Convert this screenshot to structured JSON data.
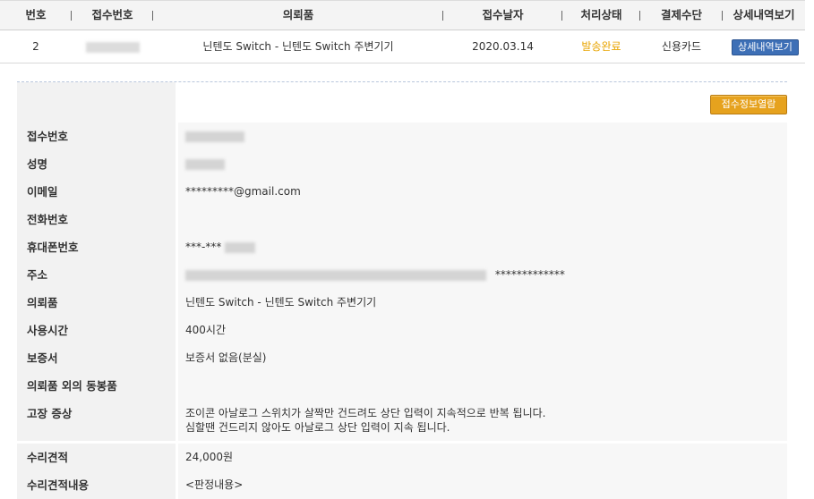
{
  "table": {
    "headers": [
      "번호",
      "접수번호",
      "의뢰품",
      "접수날자",
      "처리상태",
      "결제수단",
      "상세내역보기"
    ],
    "row": {
      "no": "2",
      "item": "닌텐도 Switch - 닌텐도 Switch 주변기기",
      "date": "2020.03.14",
      "status": "발송완료",
      "payment": "신용카드",
      "detail_button": "상세내역보기"
    }
  },
  "detail": {
    "open_button": "접수정보열람",
    "fields": [
      {
        "label": "접수번호",
        "value": ""
      },
      {
        "label": "성명",
        "value": ""
      },
      {
        "label": "이메일",
        "value": "*********@gmail.com"
      },
      {
        "label": "전화번호",
        "value": ""
      },
      {
        "label": "휴대폰번호",
        "value": "***-***"
      },
      {
        "label": "주소",
        "value": "*************"
      },
      {
        "label": "의뢰품",
        "value": "닌텐도 Switch - 닌텐도 Switch 주변기기"
      },
      {
        "label": "사용시간",
        "value": "400시간"
      },
      {
        "label": "보증서",
        "value": "보증서 없음(분실)"
      },
      {
        "label": "의뢰품 외의 동봉품",
        "value": ""
      },
      {
        "label": "고장 증상",
        "line1": "조이콘 아날로그 스위치가 살짝만 건드려도 상단 입력이 지속적으로 반복 됩니다.",
        "line2": "심할땐 건드리지 않아도 아날로그 상단 입력이 지속 됩니다."
      },
      {
        "label": "수리견적",
        "value": "24,000원"
      },
      {
        "label": "수리견적내용",
        "value": "<판정내용>"
      }
    ]
  }
}
